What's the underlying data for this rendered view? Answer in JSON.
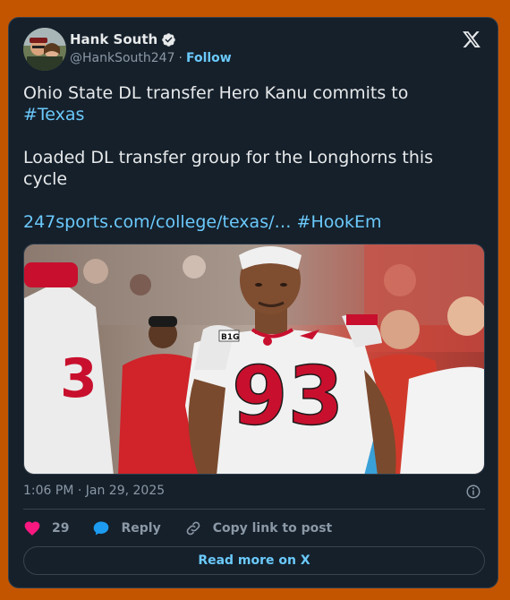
{
  "author": {
    "name": "Hank South",
    "handle": "@HankSouth247",
    "separator": "·",
    "follow_label": "Follow"
  },
  "tweet": {
    "line1": "Ohio State DL transfer Hero Kanu commits to",
    "hashtag1": "#Texas",
    "line2": "Loaded DL transfer group for the Longhorns this cycle",
    "link": "247sports.com/college/texas/…",
    "hashtag2": "#HookEm"
  },
  "photo": {
    "jersey_number": "93",
    "logo_text": "B1G"
  },
  "timestamp": "1:06 PM · Jan 29, 2025",
  "actions": {
    "like_count": "29",
    "reply_label": "Reply",
    "copy_label": "Copy link to post"
  },
  "read_more_label": "Read more on X",
  "colors": {
    "background": "#c45500",
    "card": "#15202b",
    "link": "#6bc9fb",
    "heart": "#f91880",
    "reply": "#1d9bf0",
    "verified": "#e7e9ea"
  },
  "icons": [
    "verified-icon",
    "x-logo-icon",
    "info-icon",
    "heart-icon",
    "reply-icon",
    "link-icon"
  ]
}
